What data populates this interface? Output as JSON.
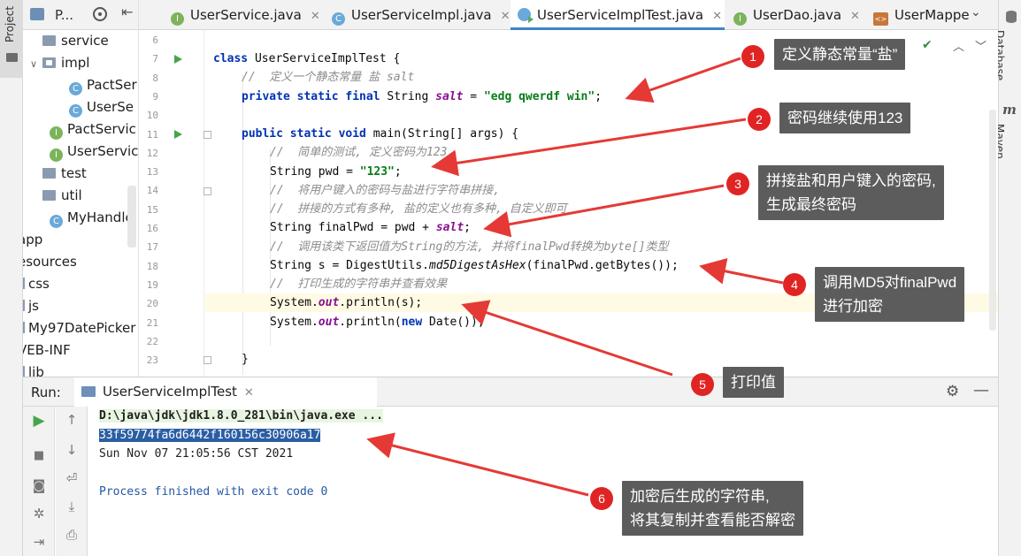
{
  "left_strip": {
    "label": "Project"
  },
  "right_strip": {
    "database_label": "Database",
    "maven_label": "Maven"
  },
  "project_panel": {
    "header_label": "P...",
    "items": [
      {
        "label": "service",
        "icon": "folder-icon",
        "indent": 1,
        "arrow": ""
      },
      {
        "label": "impl",
        "icon": "folder-icon",
        "indent": 1,
        "arrow": "expanded"
      },
      {
        "label": "PactSer",
        "icon": "class-icon",
        "indent": 3,
        "arrow": ""
      },
      {
        "label": "UserSe",
        "icon": "class-icon",
        "indent": 3,
        "arrow": ""
      },
      {
        "label": "PactServic",
        "icon": "interface-icon",
        "indent": 2,
        "arrow": ""
      },
      {
        "label": "UserServic",
        "icon": "interface-icon",
        "indent": 2,
        "arrow": ""
      },
      {
        "label": "test",
        "icon": "folder-icon",
        "indent": 1,
        "arrow": ""
      },
      {
        "label": "util",
        "icon": "folder-icon",
        "indent": 1,
        "arrow": ""
      },
      {
        "label": "MyHandle",
        "icon": "class-icon",
        "indent": 2,
        "arrow": ""
      },
      {
        "label": "app",
        "icon": "",
        "indent": 0,
        "arrow": ""
      },
      {
        "label": "esources",
        "icon": "",
        "indent": 0,
        "arrow": ""
      },
      {
        "label": "css",
        "icon": "small-folder-icon",
        "indent": 0,
        "arrow": ""
      },
      {
        "label": "js",
        "icon": "small-folder-icon",
        "indent": 0,
        "arrow": ""
      },
      {
        "label": "My97DatePicker",
        "icon": "small-folder-icon",
        "indent": 0,
        "arrow": ""
      },
      {
        "label": "VEB-INF",
        "icon": "",
        "indent": 0,
        "arrow": ""
      },
      {
        "label": "lib",
        "icon": "small-folder-icon",
        "indent": 0,
        "arrow": ""
      }
    ]
  },
  "tabs": [
    {
      "label": "UserService.java",
      "icon": "interface-icon",
      "active": false
    },
    {
      "label": "UserServiceImpl.java",
      "icon": "class-icon",
      "active": false
    },
    {
      "label": "UserServiceImplTest.java",
      "icon": "test-class-icon",
      "active": true
    },
    {
      "label": "UserDao.java",
      "icon": "interface-icon",
      "active": false
    },
    {
      "label": "UserMappe",
      "icon": "xml-icon",
      "active": false
    }
  ],
  "editor": {
    "line_numbers": [
      "6",
      "7",
      "8",
      "9",
      "10",
      "11",
      "12",
      "13",
      "14",
      "15",
      "16",
      "17",
      "18",
      "19",
      "20",
      "21",
      "22",
      "23"
    ],
    "code": {
      "l7_kw": "class ",
      "l7_rest": "UserServiceImplTest {",
      "l8": "//  定义一个静态常量 盐 salt",
      "l9_kw": "private static final ",
      "l9_type": "String ",
      "l9_field": "salt",
      "l9_eq": " = ",
      "l9_str": "\"edg qwerdf win\"",
      "l9_end": ";",
      "l11_kw": "public static void ",
      "l11_rest": "main(String[] args) {",
      "l12": "//  简单的测试, 定义密码为123",
      "l13_type": "String pwd = ",
      "l13_str": "\"123\"",
      "l13_end": ";",
      "l14": "//  将用户键入的密码与盐进行字符串拼接,",
      "l15": "//  拼接的方式有多种, 盐的定义也有多种, 自定义即可",
      "l16_a": "String finalPwd = pwd + ",
      "l16_field": "salt",
      "l16_end": ";",
      "l17": "//  调用该类下返回值为String的方法, 并将finalPwd转换为byte[]类型",
      "l18_a": "String s = DigestUtils.",
      "l18_method": "md5DigestAsHex",
      "l18_b": "(finalPwd.getBytes());",
      "l19": "//  打印生成的字符串并查看效果",
      "l20_a": "System.",
      "l20_field": "out",
      "l20_b": ".println(s);",
      "l21_a": "System.",
      "l21_field": "out",
      "l21_b": ".println(",
      "l21_kw": "new ",
      "l21_c": "Date());",
      "l23": "}"
    }
  },
  "run_panel": {
    "run_label": "Run:",
    "tab_label": "UserServiceImplTest",
    "console": [
      "D:\\java\\jdk\\jdk1.8.0_281\\bin\\java.exe ...",
      "33f59774fa6d6442f160156c30906a17",
      "Sun Nov 07 21:05:56 CST 2021",
      "Process finished with exit code 0"
    ]
  },
  "annotations": [
    {
      "number": "1",
      "text": "定义静态常量“盐”"
    },
    {
      "number": "2",
      "text": "密码继续使用123"
    },
    {
      "number": "3",
      "lines": [
        "拼接盐和用户键入的密码,",
        "生成最终密码"
      ]
    },
    {
      "number": "4",
      "lines": [
        "调用MD5对finalPwd",
        "进行加密"
      ]
    },
    {
      "number": "5",
      "text": "打印值"
    },
    {
      "number": "6",
      "lines": [
        "加密后生成的字符串,",
        "将其复制并查看能否解密"
      ]
    }
  ],
  "colors": {
    "accent": "#4083c9",
    "annotation_badge": "#e02424",
    "annotation_box": "#5c5c5c",
    "keyword": "#0033b3",
    "string": "#067d17",
    "field": "#871094",
    "comment": "#8c8c8c",
    "selection": "#2a5ea3"
  }
}
